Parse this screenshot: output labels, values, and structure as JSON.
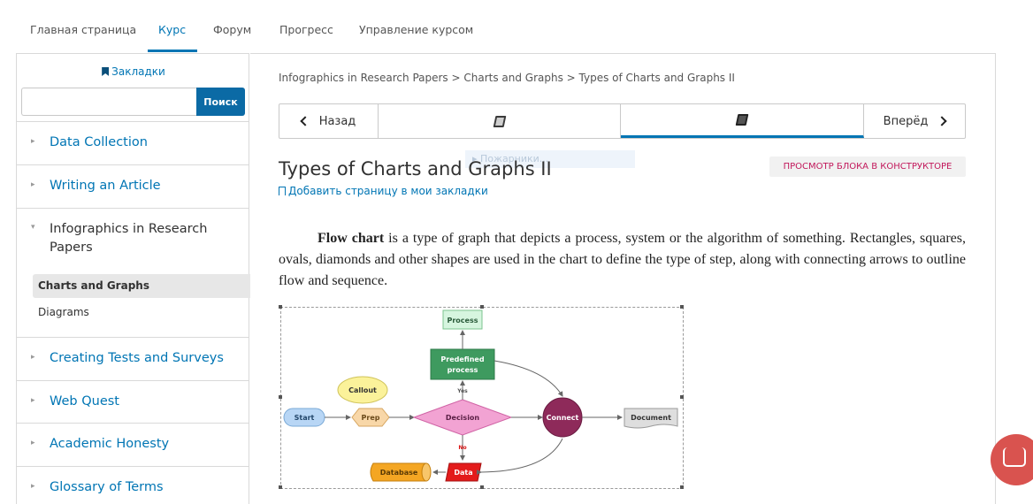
{
  "tabs": [
    {
      "label": "Главная страница"
    },
    {
      "label": "Курс"
    },
    {
      "label": "Форум"
    },
    {
      "label": "Прогресс"
    },
    {
      "label": "Управление курсом"
    }
  ],
  "sidebar": {
    "bookmarks_label": "Закладки",
    "search_placeholder": "",
    "search_button": "Поиск",
    "sections": [
      {
        "label": "Data Collection"
      },
      {
        "label": "Writing an Article"
      },
      {
        "label": "Infographics in Research Papers"
      },
      {
        "label": "Creating Tests and Surveys"
      },
      {
        "label": "Web Quest"
      },
      {
        "label": "Academic Honesty"
      },
      {
        "label": "Glossary of Terms"
      }
    ],
    "subsections": [
      {
        "label": "Charts and Graphs"
      },
      {
        "label": "Diagrams"
      }
    ]
  },
  "main": {
    "breadcrumb": "Infographics in Research Papers > Charts and Graphs > Types of Charts and Graphs II",
    "prev_label": "Назад",
    "next_label": "Вперёд",
    "tooltip": "Пожарники...",
    "title": "Types of Charts and Graphs II",
    "add_bookmark": "Добавить страницу в мои закладки",
    "studio_button": "ПРОСМОТР БЛОКА В КОНСТРУКТОРЕ",
    "paragraph_bold": "Flow chart",
    "paragraph_rest": " is a type of graph that depicts a process, system or the algorithm of something. Rectangles, squares, ovals, diamonds and other shapes are used in the chart to define the type of step, along with connecting arrows to outline flow and sequence."
  },
  "figure": {
    "nodes": {
      "process": "Process",
      "predefined_1": "Predefined",
      "predefined_2": "process",
      "callout": "Callout",
      "start": "Start",
      "prep": "Prep",
      "decision": "Decision",
      "connect": "Connect",
      "document": "Document",
      "database": "Database",
      "data": "Data",
      "yes": "Yes",
      "no": "No"
    }
  },
  "colors": {
    "accent": "#0075b4",
    "search_button": "#0b6aa5",
    "studio_text": "#c2185b",
    "chat": "#d9534f"
  }
}
